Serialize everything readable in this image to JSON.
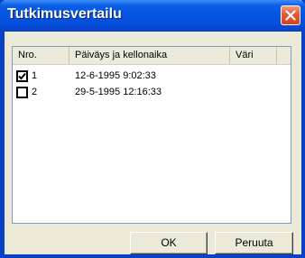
{
  "window": {
    "title": "Tutkimusvertailu"
  },
  "list": {
    "columns": [
      "Nro.",
      "Päiväys ja kellonaika",
      "Väri",
      ""
    ],
    "rows": [
      {
        "nro": "1",
        "datetime": "12-6-1995 9:02:33",
        "checked": true,
        "color": ""
      },
      {
        "nro": "2",
        "datetime": "29-5-1995 12:16:33",
        "checked": false,
        "color": ""
      }
    ]
  },
  "buttons": {
    "ok_label": "OK",
    "cancel_label": "Peruuta"
  },
  "colors": {
    "titlebar": "#0554e3",
    "frame": "#0842c7",
    "dialog_bg": "#ece9d8",
    "close_button": "#e35d3a"
  },
  "icons": {
    "close": "close-x-icon",
    "checkbox_checked": "checkmark-icon"
  }
}
